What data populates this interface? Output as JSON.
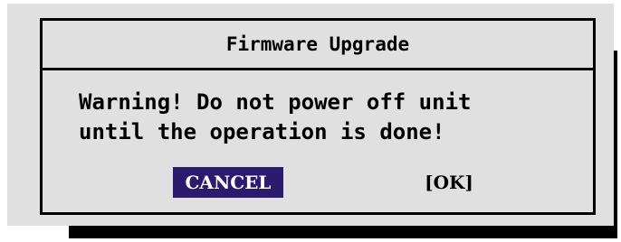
{
  "dialog": {
    "title": "Firmware Upgrade",
    "message_lines": [
      "Warning! Do not power off unit",
      "until the operation is done!"
    ],
    "buttons": {
      "cancel_label": "CANCEL",
      "ok_label": "[OK]"
    }
  },
  "colors": {
    "panel_bg": "#e0e0e0",
    "selected_button_bg": "#2a1b6e",
    "selected_button_text": "#ffffff",
    "text": "#000000"
  }
}
